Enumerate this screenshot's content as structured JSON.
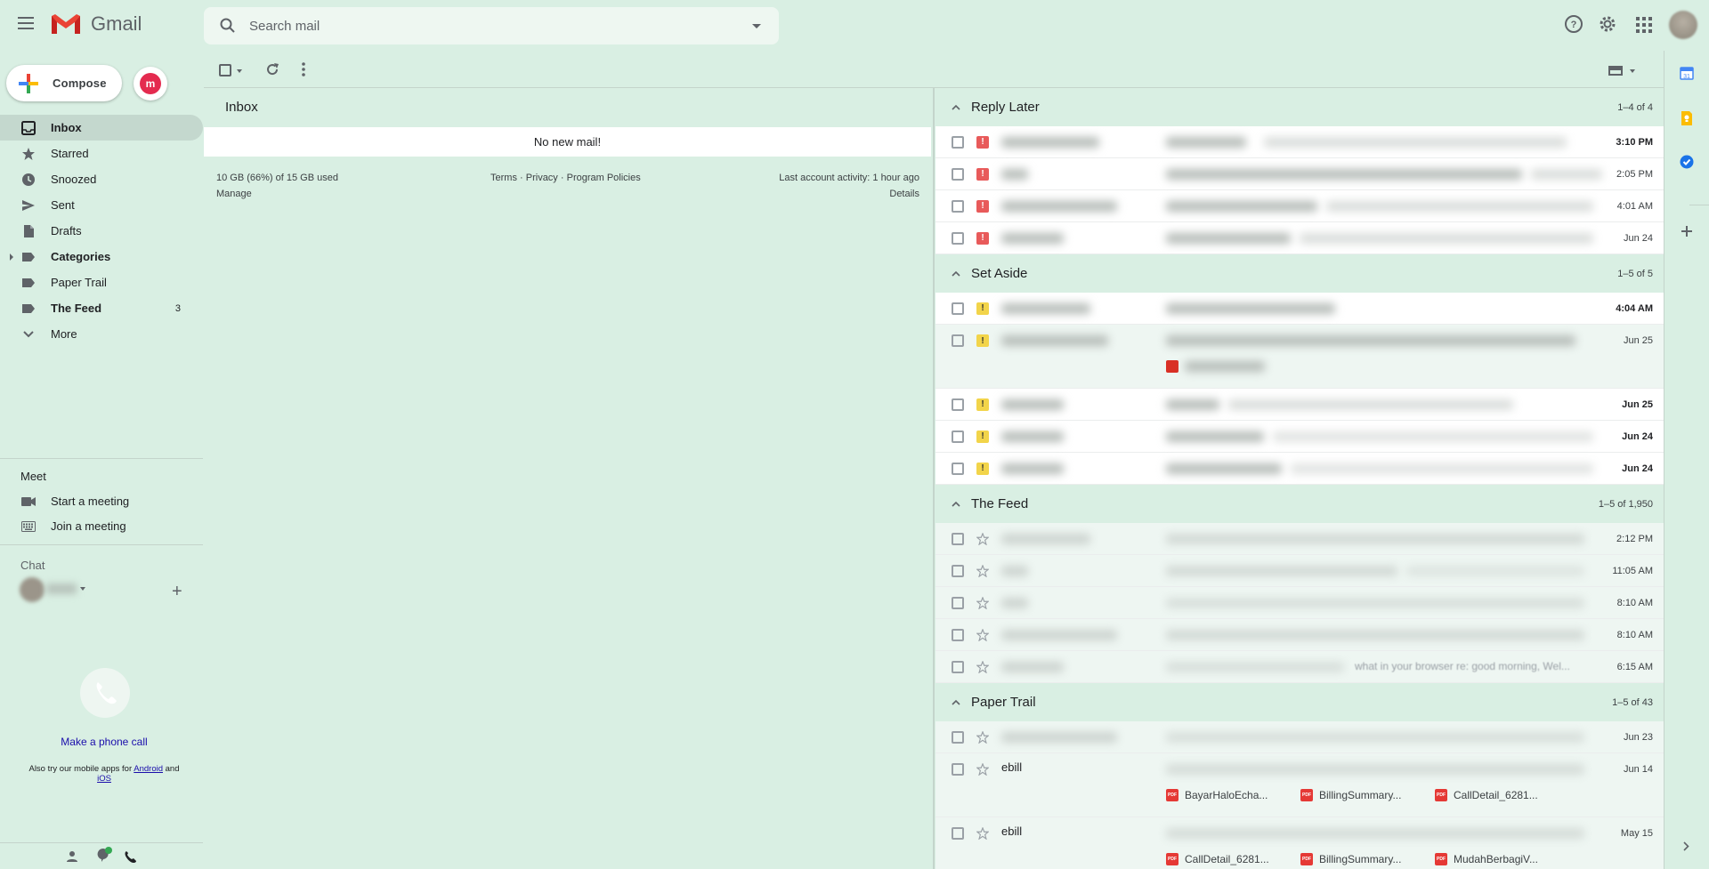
{
  "header": {
    "app_name": "Gmail",
    "search_placeholder": "Search mail",
    "icons": [
      "menu-icon",
      "help-icon",
      "settings-icon",
      "apps-icon"
    ]
  },
  "compose": {
    "label": "Compose"
  },
  "nav": {
    "items": [
      {
        "label": "Inbox",
        "icon": "inbox-icon",
        "count": ""
      },
      {
        "label": "Starred",
        "icon": "star-icon",
        "count": ""
      },
      {
        "label": "Snoozed",
        "icon": "clock-icon",
        "count": ""
      },
      {
        "label": "Sent",
        "icon": "send-icon",
        "count": ""
      },
      {
        "label": "Drafts",
        "icon": "draft-icon",
        "count": ""
      },
      {
        "label": "Categories",
        "icon": "label-icon",
        "count": ""
      },
      {
        "label": "Paper Trail",
        "icon": "label-icon",
        "count": ""
      },
      {
        "label": "The Feed",
        "icon": "label-icon",
        "count": "3"
      },
      {
        "label": "More",
        "icon": "chevron-down-icon",
        "count": ""
      }
    ]
  },
  "meet": {
    "title": "Meet",
    "start": "Start a meeting",
    "join": "Join a meeting"
  },
  "chat": {
    "title": "Chat",
    "phone_call": "Make a phone call",
    "mobile_prefix": "Also try our mobile apps for",
    "android": "Android",
    "and": "and",
    "ios": "iOS"
  },
  "inbox": {
    "title": "Inbox",
    "empty": "No new mail!",
    "storage": "10 GB (66%) of 15 GB used",
    "manage": "Manage",
    "terms": "Terms",
    "privacy": "Privacy",
    "policies": "Program Policies",
    "sep": "·",
    "activity": "Last account activity: 1 hour ago",
    "details": "Details"
  },
  "sections": {
    "reply_later": {
      "title": "Reply Later",
      "range": "1–4 of 4",
      "rows": [
        {
          "time": "3:10 PM"
        },
        {
          "time": "2:05 PM"
        },
        {
          "time": "4:01 AM"
        },
        {
          "time": "Jun 24"
        }
      ]
    },
    "set_aside": {
      "title": "Set Aside",
      "range": "1–5 of 5",
      "rows": [
        {
          "time": "4:04 AM"
        },
        {
          "time": "Jun 25"
        },
        {
          "time": "Jun 25"
        },
        {
          "time": "Jun 24"
        },
        {
          "time": "Jun 24"
        }
      ]
    },
    "the_feed": {
      "title": "The Feed",
      "range": "1–5 of 1,950",
      "rows": [
        {
          "time": "2:12 PM"
        },
        {
          "time": "11:05 AM"
        },
        {
          "time": "8:10 AM"
        },
        {
          "time": "8:10 AM"
        },
        {
          "time": "6:15 AM",
          "snippet": "what in your browser re: good morning, Wel..."
        }
      ]
    },
    "paper_trail": {
      "title": "Paper Trail",
      "range": "1–5 of 43",
      "rows": [
        {
          "sender": "",
          "time": "Jun 23"
        },
        {
          "sender": "ebill",
          "time": "Jun 14",
          "attachments": [
            "BayarHaloEcha...",
            "BillingSummary...",
            "CallDetail_6281..."
          ]
        },
        {
          "sender": "ebill",
          "time": "May 15",
          "attachments": [
            "CallDetail_6281...",
            "BillingSummary...",
            "MudahBerbagiV..."
          ]
        }
      ]
    }
  },
  "colors": {
    "background": "#d9efe3",
    "important_red": "#e85a5a",
    "important_yellow": "#f2d44a",
    "pdf_red": "#e53935",
    "link_blue": "#1a0dab"
  }
}
